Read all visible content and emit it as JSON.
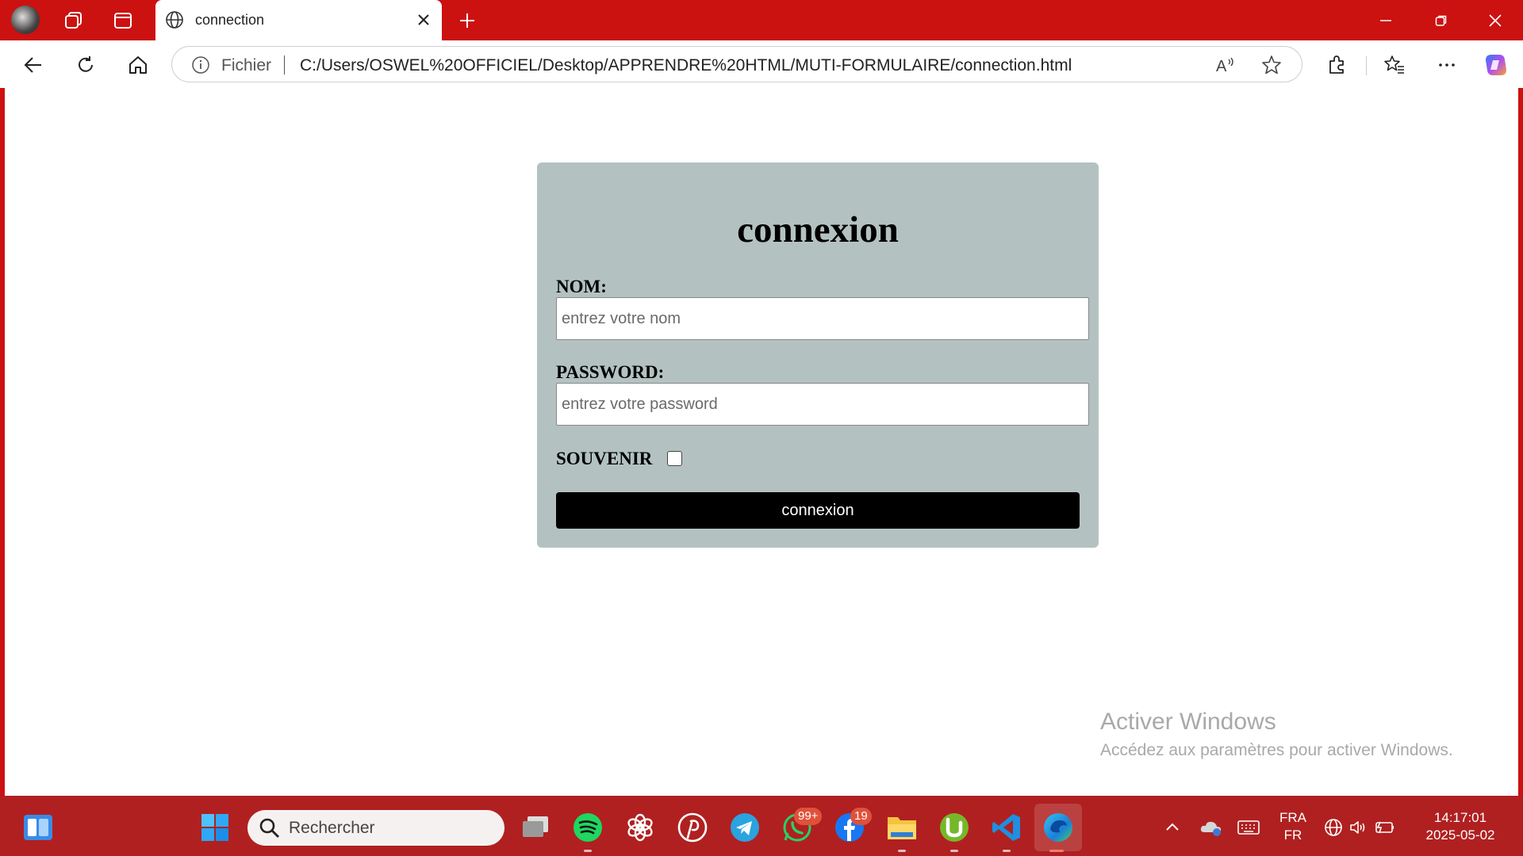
{
  "browser": {
    "tab_title": "connection",
    "address": {
      "scheme_label": "Fichier",
      "url": "C:/Users/OSWEL%20OFFICIEL/Desktop/APPRENDRE%20HTML/MUTI-FORMULAIRE/connection.html"
    }
  },
  "page": {
    "form": {
      "title": "connexion",
      "name_label": "NOM:",
      "name_placeholder": "entrez votre nom",
      "password_label": "PASSWORD:",
      "password_placeholder": "entrez votre password",
      "remember_label": "SOUVENIR",
      "remember_checked": false,
      "submit_label": "connexion"
    },
    "watermark": {
      "title": "Activer Windows",
      "subtitle": "Accédez aux paramètres pour activer Windows."
    }
  },
  "taskbar": {
    "search_placeholder": "Rechercher",
    "whatsapp_badge": "99+",
    "facebook_badge": "19",
    "language_top": "FRA",
    "language_bottom": "FR",
    "time": "14:17:01",
    "date": "2025-05-02"
  },
  "colors": {
    "titlebar": "#cc1111",
    "taskbar": "#b02020",
    "form_bg": "#b3c2c1",
    "button_bg": "#000000"
  }
}
